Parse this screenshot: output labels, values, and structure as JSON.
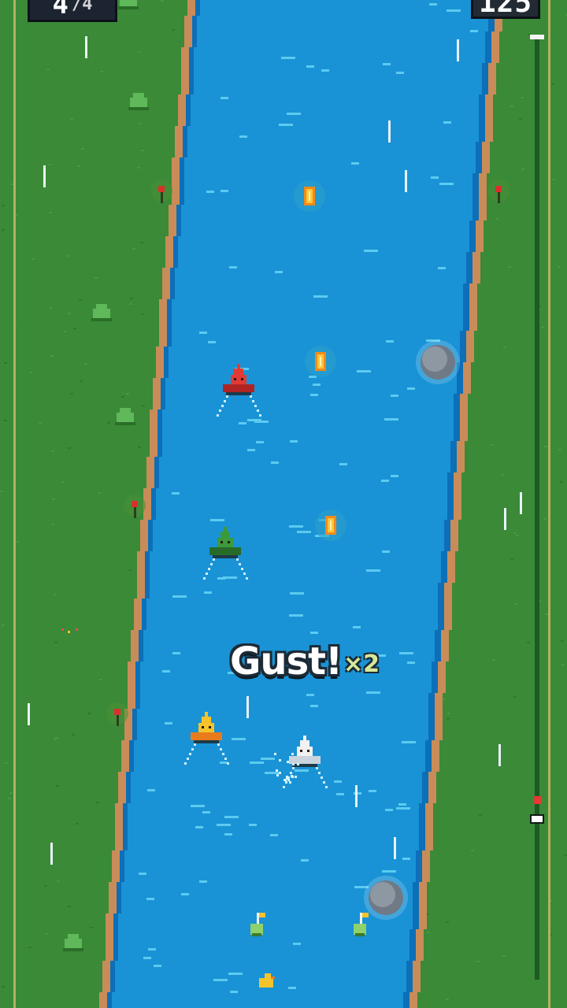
{
  "hud": {
    "race_position": "4",
    "race_total": "/4",
    "score": "125"
  },
  "callout": {
    "text": "Gust!",
    "multiplier": "×2"
  },
  "progress": {
    "player_fraction": 0.17,
    "rival_fraction": 0.19
  },
  "colors": {
    "grass": "#3a8a37",
    "grass_dark": "#2f7a2e",
    "bank": "#c98c59",
    "water": "#1993d6",
    "water_deep": "#0c6fb8",
    "frame": "#c9b86a"
  },
  "boats": [
    {
      "name": "red-boat",
      "sail": "#e23b34",
      "hull": "#b02424"
    },
    {
      "name": "green-boat",
      "sail": "#3b9a3a",
      "hull": "#286b29"
    },
    {
      "name": "yellow-boat",
      "sail": "#f5c32a",
      "hull": "#e87b1c"
    },
    {
      "name": "player-boat",
      "sail": "#f1f1f1",
      "hull": "#c9d4de"
    }
  ],
  "icons": [
    "coin-icon",
    "rock-icon",
    "buoy-icon",
    "bush-icon",
    "flower-icon",
    "duck-icon"
  ]
}
